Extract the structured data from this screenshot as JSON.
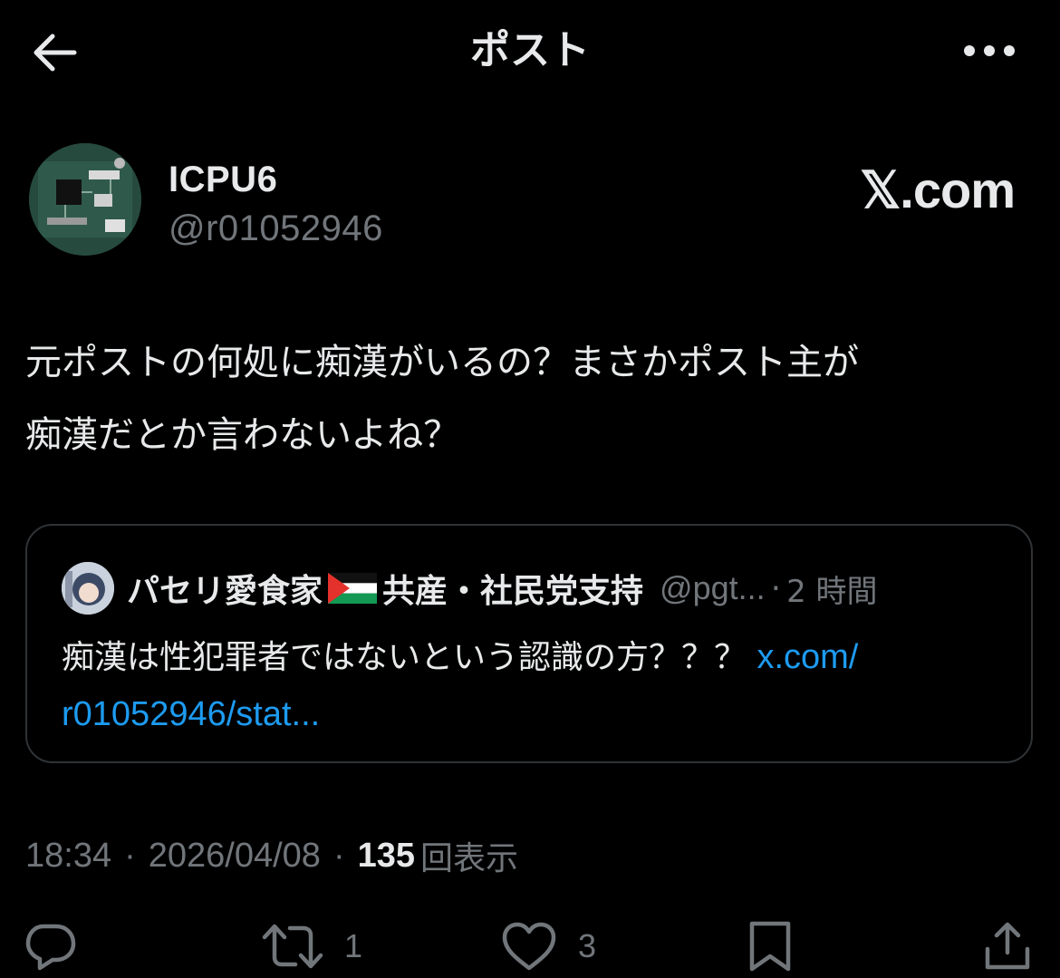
{
  "header": {
    "title": "ポスト",
    "back_icon": "arrow-left-icon",
    "more_icon": "more-horizontal-icon"
  },
  "author": {
    "display_name": "ICPU6",
    "handle": "@r01052946",
    "source_badge": "𝕏.com"
  },
  "post": {
    "text_line1": "元ポストの何処に痴漢がいるの？まさかポスト主が",
    "text_line2": "痴漢だとか言わないよね？"
  },
  "quote": {
    "name_part1": "パセリ愛食家",
    "flag_icon": "palestine-flag-icon",
    "name_part2": "共産・社民党支持",
    "handle": "@pgt...",
    "separator": "·",
    "time": "2 時間",
    "text": "痴漢は性犯罪者ではないという認識の方？？？ ",
    "link_line1": "x.com/",
    "link_line2": "r01052946/stat..."
  },
  "meta": {
    "time": "18:34",
    "separator": "·",
    "date": "2026/04/08",
    "views_count": "135",
    "views_label": "回表示"
  },
  "actions": {
    "reply_count": "",
    "repost_count": "1",
    "like_count": "3"
  },
  "colors": {
    "background": "#000000",
    "text": "#e7e9ea",
    "secondary": "#71767b",
    "link": "#1d9bf0",
    "border": "#2f3336"
  }
}
